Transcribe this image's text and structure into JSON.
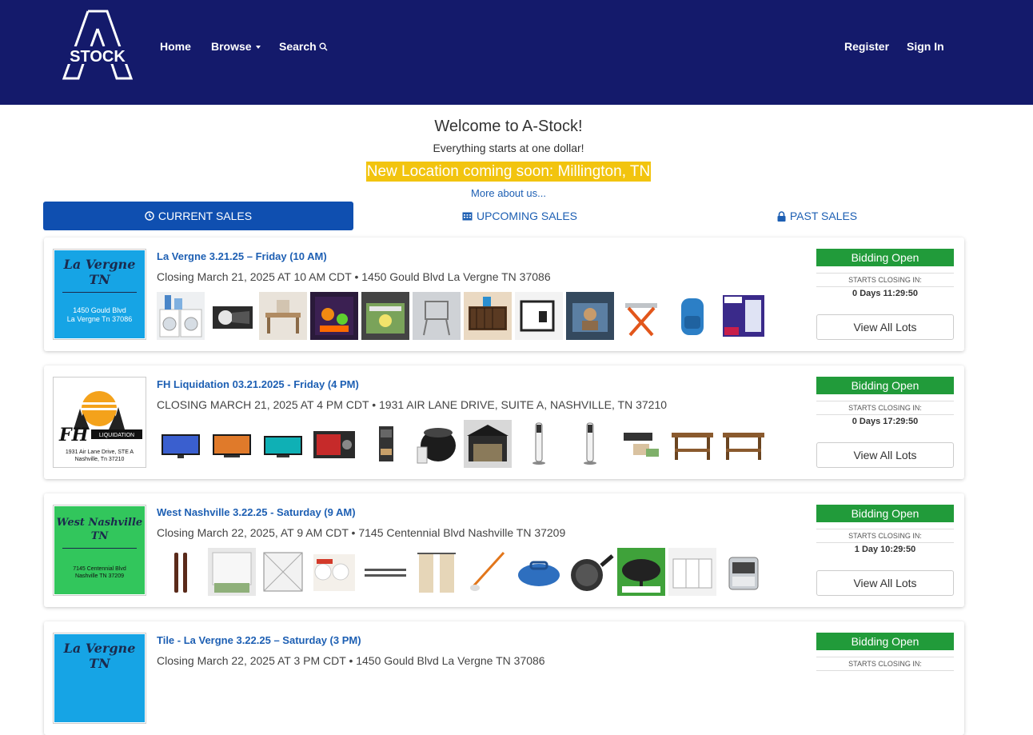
{
  "nav": {
    "logo_text": "STOCK",
    "links": {
      "home": "Home",
      "browse": "Browse",
      "search": "Search",
      "register": "Register",
      "signin": "Sign In"
    },
    "background": "#141a6b"
  },
  "welcome": {
    "title": "Welcome to A-Stock!",
    "subtitle": "Everything starts at one dollar!",
    "announcement": "New Location coming soon: Millington, TN",
    "more_link": "More about us..."
  },
  "tabs": {
    "current": "CURRENT SALES",
    "upcoming": "UPCOMING SALES",
    "past": "PAST SALES"
  },
  "status": {
    "bidding_open": "Bidding Open",
    "starts_closing": "STARTS CLOSING IN:",
    "view_all": "View All Lots"
  },
  "sales": [
    {
      "title": "La Vergne 3.21.25 – Friday (10 AM)",
      "subtitle": "Closing March 21, 2025 AT 10 AM CDT • 1450 Gould Blvd La Vergne TN 37086",
      "countdown": "0 Days 11:29:50",
      "thumb": {
        "name": "La Vergne\nTN",
        "address": "1450 Gould Blvd\nLa Vergne Tn 37086",
        "color": "#16a4e5"
      }
    },
    {
      "title": "FH Liquidation 03.21.2025 - Friday (4 PM)",
      "subtitle": "CLOSING MARCH 21, 2025 AT 4 PM CDT • 1931 AIR LANE DRIVE, SUITE A, NASHVILLE, TN 37210",
      "countdown": "0 Days 17:29:50",
      "thumb": {
        "logo": "LIQUIDATION",
        "address": "1931 Air Lane Drive, STE A\nNashville, Tn 37210"
      }
    },
    {
      "title": "West Nashville 3.22.25 - Saturday (9 AM)",
      "subtitle": "Closing March 22, 2025, AT 9 AM CDT • 7145 Centennial Blvd Nashville TN 37209",
      "countdown": "1 Day 10:29:50",
      "thumb": {
        "name": "West Nashville\nTN",
        "address": "7145 Centennial Blvd\nNashville TN 37209",
        "color": "#32c65c"
      }
    },
    {
      "title": "Tile - La Vergne 3.22.25 – Saturday (3 PM)",
      "subtitle": "Closing March 22, 2025 AT 3 PM CDT • 1450 Gould Blvd La Vergne TN 37086",
      "thumb": {
        "name": "La Vergne\nTN",
        "color": "#16a4e5"
      }
    }
  ],
  "item_icons": {
    "sale1": [
      "washer-dryer-image",
      "flashlight-image",
      "furniture-image",
      "halloween-decor-image",
      "storage-box-image",
      "chair-image",
      "cabinet-image",
      "photo-lightbox-image",
      "car-seat-image",
      "workbench-image",
      "backpack-image",
      "tena-briefs-image"
    ],
    "sale2": [
      "tv-image",
      "tv-image",
      "tv-image",
      "projector-box-image",
      "coffee-maker-image",
      "pressure-cooker-image",
      "canopy-image",
      "tower-fan-image",
      "tower-fan-image",
      "vacuum-sealer-image",
      "bench-image",
      "bench-image"
    ],
    "sale3": [
      "door-handles-image",
      "window-blind-image",
      "air-filter-image",
      "paper-towels-image",
      "curtain-rods-image",
      "curtains-image",
      "grabber-tool-image",
      "duffel-bag-image",
      "frying-pan-image",
      "garden-umbrella-image",
      "drawer-organizer-image",
      "ice-maker-image"
    ]
  },
  "colors": {
    "accent_blue": "#0f4fb0",
    "link_blue": "#1d5fb3",
    "announcement_yellow": "#f2c40f",
    "bidding_green": "#219b3a"
  }
}
